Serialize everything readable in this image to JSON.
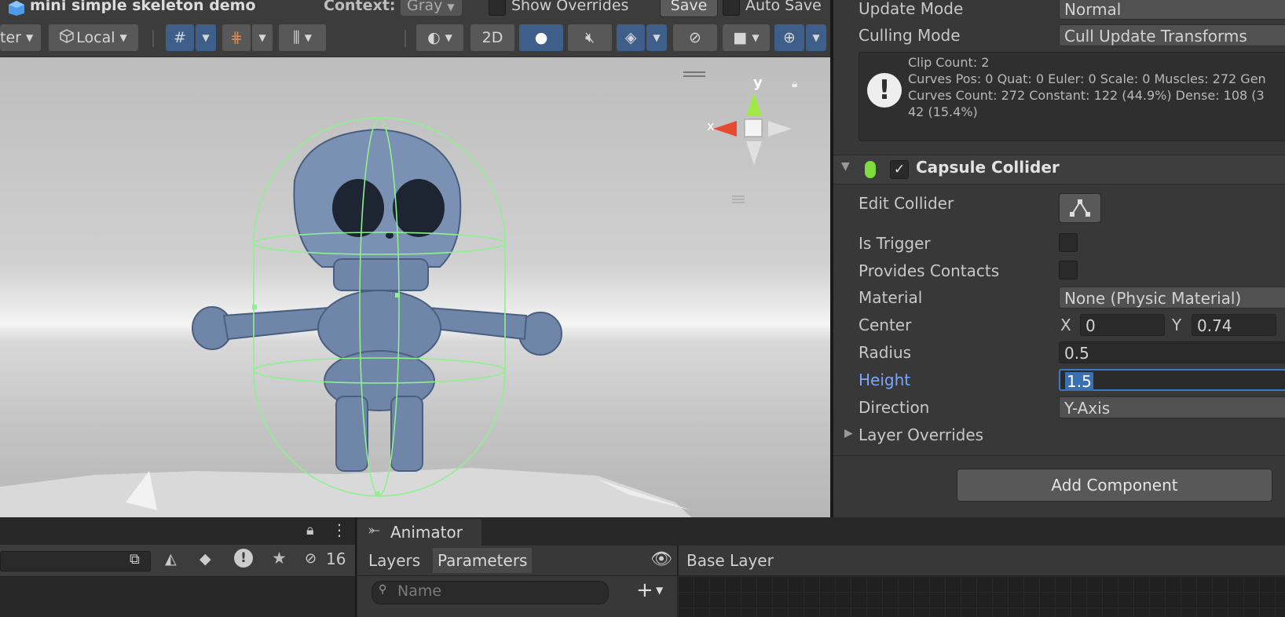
{
  "scene": {
    "title": "mini simple skeleton demo",
    "context_label": "Context:",
    "context_value": "Gray",
    "show_overrides": "Show Overrides",
    "save": "Save",
    "auto_save": "Auto Save",
    "pivot_partial": "ter",
    "local": "Local",
    "mode_2d": "2D",
    "gizmo_y": "y",
    "gizmo_x": "x"
  },
  "inspector": {
    "update_mode_label": "Update Mode",
    "update_mode_value": "Normal",
    "culling_mode_label": "Culling Mode",
    "culling_mode_value": "Cull Update Transforms",
    "info_lines": [
      "Clip Count: 2",
      "Curves Pos: 0 Quat: 0 Euler: 0 Scale: 0 Muscles: 272 Gen",
      "Curves Count: 272 Constant: 122 (44.9%) Dense: 108 (3",
      "42 (15.4%)"
    ],
    "component_title": "Capsule Collider",
    "edit_collider": "Edit Collider",
    "is_trigger": "Is Trigger",
    "provides_contacts": "Provides Contacts",
    "material_label": "Material",
    "material_value": "None (Physic Material)",
    "center_label": "Center",
    "center_x_label": "X",
    "center_x": "0",
    "center_y_label": "Y",
    "center_y": "0.74",
    "radius_label": "Radius",
    "radius_value": "0.5",
    "height_label": "Height",
    "height_value": "1.5",
    "direction_label": "Direction",
    "direction_value": "Y-Axis",
    "layer_overrides": "Layer Overrides",
    "add_component": "Add Component"
  },
  "bottom": {
    "hidden_count": "16",
    "animator_tab": "Animator",
    "layers_tab": "Layers",
    "parameters_tab": "Parameters",
    "base_layer": "Base Layer",
    "search_placeholder": "Name"
  },
  "colors": {
    "accent_blue": "#3d5f8a",
    "collider_green": "#8ef08e",
    "height_label_blue": "#7aa7ff"
  }
}
